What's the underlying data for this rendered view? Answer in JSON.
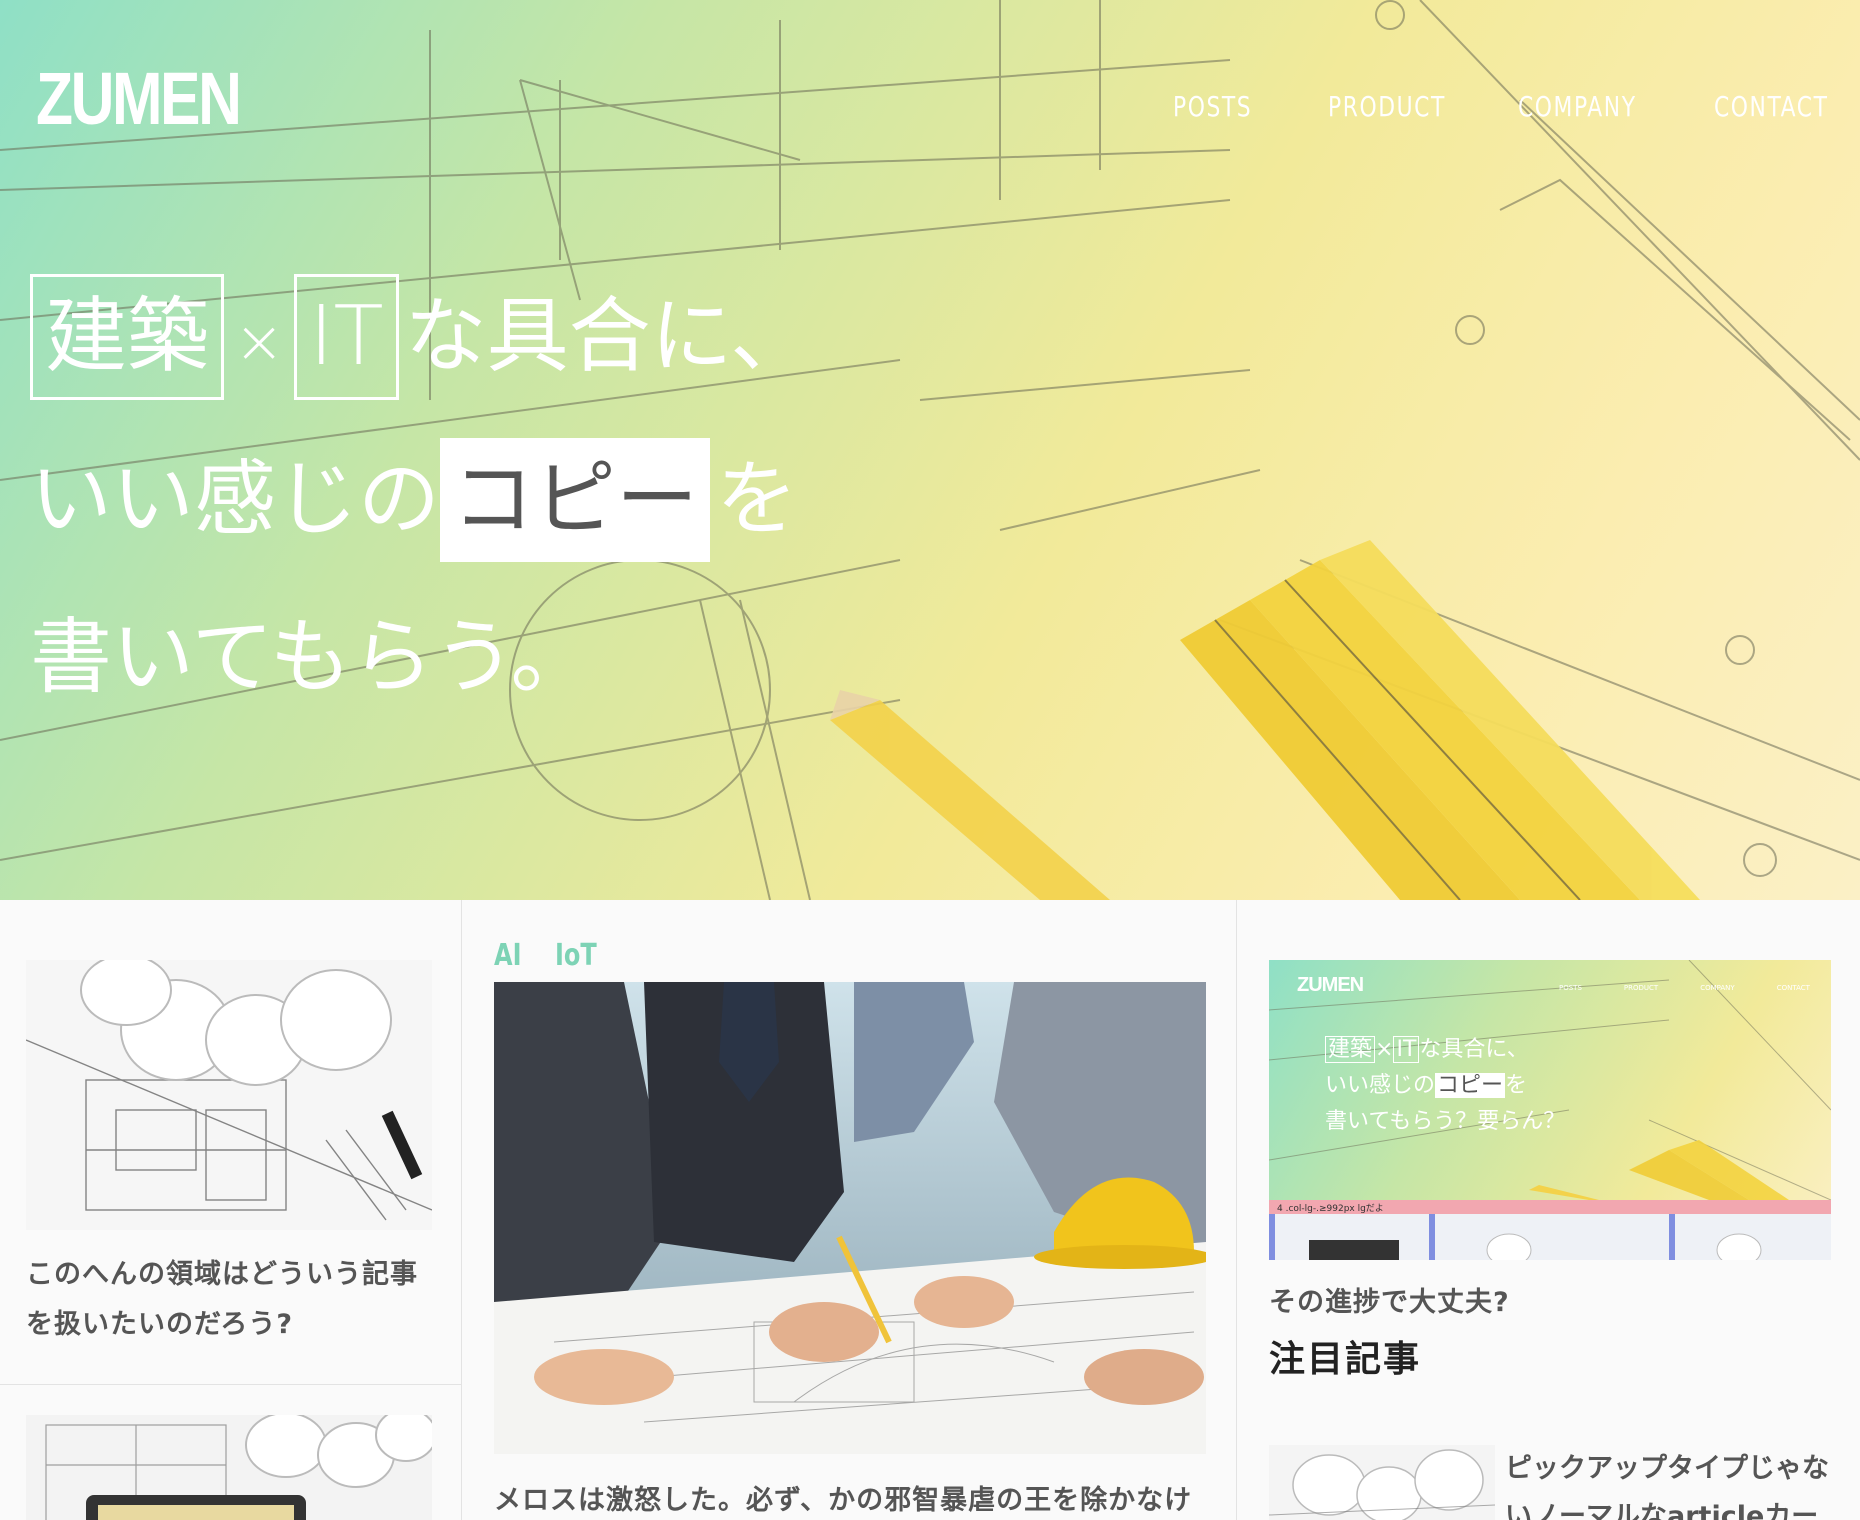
{
  "header": {
    "logo": "ZUMEN",
    "nav": [
      "POSTS",
      "PRODUCT",
      "COMPANY",
      "CONTACT"
    ]
  },
  "hero": {
    "line1": {
      "box1": "建築",
      "times": "×",
      "box2": "IT",
      "rest": "な具合に、"
    },
    "line2": {
      "pre": "いい感じの",
      "highlight": "コピー",
      "post": "を"
    },
    "line3": "書いてもらう。"
  },
  "cards": {
    "left_card_1_title": "このへんの領域はどういう記事を扱いたいのだろう?",
    "middle_card": {
      "tags": [
        "AI",
        "IoT"
      ],
      "title": "メロスは激怒した。必ず、かの邪智暴虐の王を除かなけ"
    },
    "right_card": {
      "preview": {
        "logo": "ZUMEN",
        "nav": [
          "POSTS",
          "PRODUCT",
          "COMPANY",
          "CONTACT"
        ],
        "line1": {
          "box1": "建築",
          "times": "×",
          "box2": "IT",
          "rest": "な具合に、"
        },
        "line2": {
          "pre": "いい感じの",
          "highlight": "コピー",
          "post": "を"
        },
        "line3": "書いてもらう？要らん？",
        "debug_bar": "4 .col-lg-.≥992px lgだよ"
      },
      "title": "その進捗で大丈夫?"
    }
  },
  "featured": {
    "section_title": "注目記事",
    "item_title": "ピックアップタイプじゃないノーマルなarticleカード"
  },
  "colors": {
    "accent": "#7dd3b5",
    "text": "#555555",
    "hero_gradient": [
      "#8fe0c6",
      "#f2ea9a",
      "#fbf0c6"
    ]
  }
}
